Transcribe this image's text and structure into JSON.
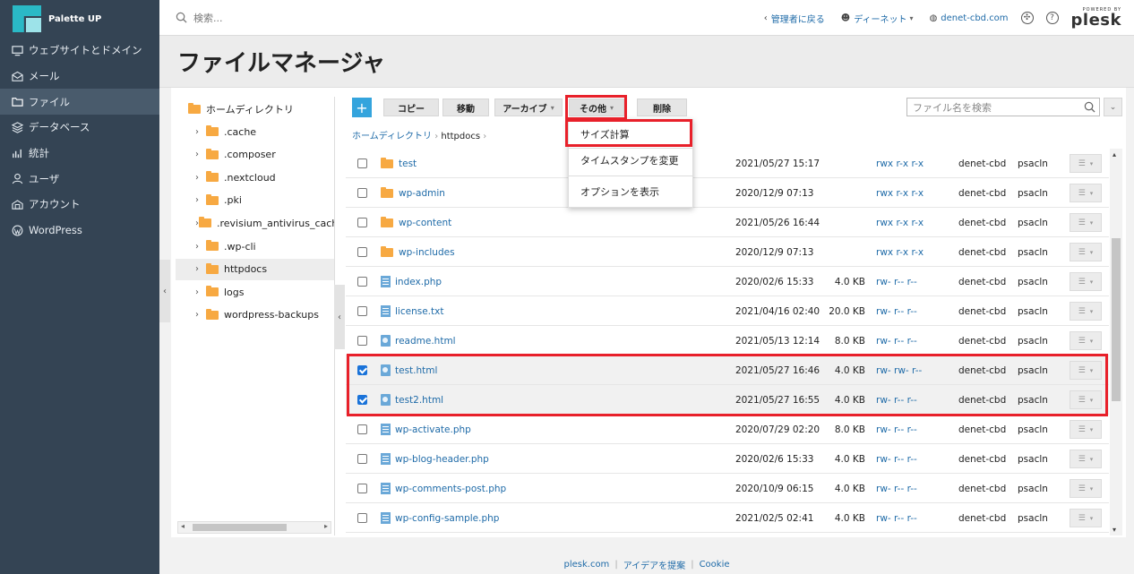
{
  "app": {
    "brand": "Palette UP"
  },
  "sidebar": {
    "items": [
      {
        "label": "ウェブサイトとドメイン",
        "icon": "monitor-icon"
      },
      {
        "label": "メール",
        "icon": "mail-icon"
      },
      {
        "label": "ファイル",
        "icon": "folder-icon",
        "active": true
      },
      {
        "label": "データベース",
        "icon": "database-icon"
      },
      {
        "label": "統計",
        "icon": "stats-icon"
      },
      {
        "label": "ユーザ",
        "icon": "user-icon"
      },
      {
        "label": "アカウント",
        "icon": "account-icon"
      },
      {
        "label": "WordPress",
        "icon": "wordpress-icon"
      }
    ]
  },
  "topbar": {
    "search_placeholder": "検索...",
    "back_admin": "管理者に戻る",
    "user": "ディーネット",
    "domain": "denet-cbd.com",
    "powered_by": "POWERED BY",
    "plesk": "plesk"
  },
  "header": {
    "title": "ファイルマネージャ"
  },
  "tree": {
    "root": "ホームディレクトリ",
    "items": [
      ".cache",
      ".composer",
      ".nextcloud",
      ".pki",
      ".revisium_antivirus_cache",
      ".wp-cli",
      "httpdocs",
      "logs",
      "wordpress-backups"
    ],
    "selected": "httpdocs"
  },
  "toolbar": {
    "add": "+",
    "copy": "コピー",
    "move": "移動",
    "archive": "アーカイブ",
    "other": "その他",
    "delete": "削除",
    "search_placeholder": "ファイル名を検索"
  },
  "breadcrumb": {
    "root": "ホームディレクトリ",
    "current": "httpdocs"
  },
  "dropdown": {
    "items": [
      "サイズ計算",
      "タイムスタンプを変更",
      "オプションを表示"
    ],
    "highlighted": "サイズ計算"
  },
  "files": [
    {
      "name": "test",
      "type": "folder",
      "date": "2021/05/27 15:17",
      "size": "",
      "perm": "rwx r-x r-x",
      "user": "denet-cbd",
      "group": "psacln",
      "checked": false
    },
    {
      "name": "wp-admin",
      "type": "folder",
      "date": "2020/12/9 07:13",
      "size": "",
      "perm": "rwx r-x r-x",
      "user": "denet-cbd",
      "group": "psacln",
      "checked": false
    },
    {
      "name": "wp-content",
      "type": "folder",
      "date": "2021/05/26 16:44",
      "size": "",
      "perm": "rwx r-x r-x",
      "user": "denet-cbd",
      "group": "psacln",
      "checked": false
    },
    {
      "name": "wp-includes",
      "type": "folder",
      "date": "2020/12/9 07:13",
      "size": "",
      "perm": "rwx r-x r-x",
      "user": "denet-cbd",
      "group": "psacln",
      "checked": false
    },
    {
      "name": "index.php",
      "type": "file",
      "date": "2020/02/6 15:33",
      "size": "4.0 KB",
      "perm": "rw- r-- r--",
      "user": "denet-cbd",
      "group": "psacln",
      "checked": false
    },
    {
      "name": "license.txt",
      "type": "file",
      "date": "2021/04/16 02:40",
      "size": "20.0 KB",
      "perm": "rw- r-- r--",
      "user": "denet-cbd",
      "group": "psacln",
      "checked": false
    },
    {
      "name": "readme.html",
      "type": "html",
      "date": "2021/05/13 12:14",
      "size": "8.0 KB",
      "perm": "rw- r-- r--",
      "user": "denet-cbd",
      "group": "psacln",
      "checked": false
    },
    {
      "name": "test.html",
      "type": "html",
      "date": "2021/05/27 16:46",
      "size": "4.0 KB",
      "perm": "rw- rw- r--",
      "user": "denet-cbd",
      "group": "psacln",
      "checked": true
    },
    {
      "name": "test2.html",
      "type": "html",
      "date": "2021/05/27 16:55",
      "size": "4.0 KB",
      "perm": "rw- r-- r--",
      "user": "denet-cbd",
      "group": "psacln",
      "checked": true
    },
    {
      "name": "wp-activate.php",
      "type": "file",
      "date": "2020/07/29 02:20",
      "size": "8.0 KB",
      "perm": "rw- r-- r--",
      "user": "denet-cbd",
      "group": "psacln",
      "checked": false
    },
    {
      "name": "wp-blog-header.php",
      "type": "file",
      "date": "2020/02/6 15:33",
      "size": "4.0 KB",
      "perm": "rw- r-- r--",
      "user": "denet-cbd",
      "group": "psacln",
      "checked": false
    },
    {
      "name": "wp-comments-post.php",
      "type": "file",
      "date": "2020/10/9 06:15",
      "size": "4.0 KB",
      "perm": "rw- r-- r--",
      "user": "denet-cbd",
      "group": "psacln",
      "checked": false
    },
    {
      "name": "wp-config-sample.php",
      "type": "file",
      "date": "2021/02/5 02:41",
      "size": "4.0 KB",
      "perm": "rw- r-- r--",
      "user": "denet-cbd",
      "group": "psacln",
      "checked": false
    }
  ],
  "footer": {
    "links": [
      "plesk.com",
      "アイデアを提案",
      "Cookie"
    ]
  },
  "colors": {
    "sidebar": "#344454",
    "accent": "#34a4dd",
    "link": "#1f6ba8",
    "highlight": "#e8202a",
    "folder": "#f7a942"
  }
}
